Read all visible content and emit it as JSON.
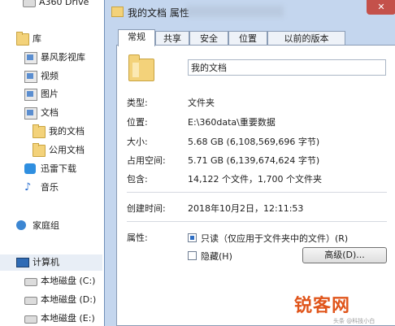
{
  "nav": {
    "items": [
      {
        "label": "A360 Drive",
        "icon": "cloud-drive-icon"
      },
      {
        "label": "库",
        "icon": "library-icon"
      },
      {
        "label": "暴风影视库",
        "icon": "library-icon"
      },
      {
        "label": "视频",
        "icon": "video-library-icon"
      },
      {
        "label": "图片",
        "icon": "picture-library-icon"
      },
      {
        "label": "文档",
        "icon": "document-library-icon"
      },
      {
        "label": "我的文档",
        "icon": "folder-icon"
      },
      {
        "label": "公用文档",
        "icon": "folder-icon"
      },
      {
        "label": "迅雷下载",
        "icon": "thunder-icon"
      },
      {
        "label": "音乐",
        "icon": "music-icon"
      },
      {
        "label": "家庭组",
        "icon": "homegroup-icon"
      },
      {
        "label": "计算机",
        "icon": "computer-icon"
      },
      {
        "label": "本地磁盘 (C:)",
        "icon": "drive-icon"
      },
      {
        "label": "本地磁盘 (D:)",
        "icon": "drive-icon"
      },
      {
        "label": "本地磁盘 (E:)",
        "icon": "drive-icon"
      }
    ]
  },
  "dialog": {
    "title": "我的文档 属性",
    "close_label": "✕",
    "tabs": [
      "常规",
      "共享",
      "安全",
      "位置",
      "以前的版本"
    ],
    "name_value": "我的文档",
    "props": {
      "type_label": "类型:",
      "type_value": "文件夹",
      "location_label": "位置:",
      "location_value": "E:\\360data\\重要数据",
      "size_label": "大小:",
      "size_value": "5.68 GB (6,108,569,696 字节)",
      "disk_label": "占用空间:",
      "disk_value": "5.71 GB (6,139,674,624 字节)",
      "contains_label": "包含:",
      "contains_value": "14,122 个文件，1,700 个文件夹",
      "created_label": "创建时间:",
      "created_value": "2018年10月2日，12:11:53",
      "attrs_label": "属性:",
      "readonly_label": "只读（仅应用于文件夹中的文件）(R)",
      "hidden_label": "隐藏(H)",
      "advanced_label": "高级(D)..."
    }
  },
  "watermark": {
    "text": "锐客网",
    "sub": "头条 @科技小白"
  },
  "colors": {
    "dialog_frame": "#c4d6ee",
    "accent": "#2e6ec4",
    "watermark": "#e0551b"
  }
}
